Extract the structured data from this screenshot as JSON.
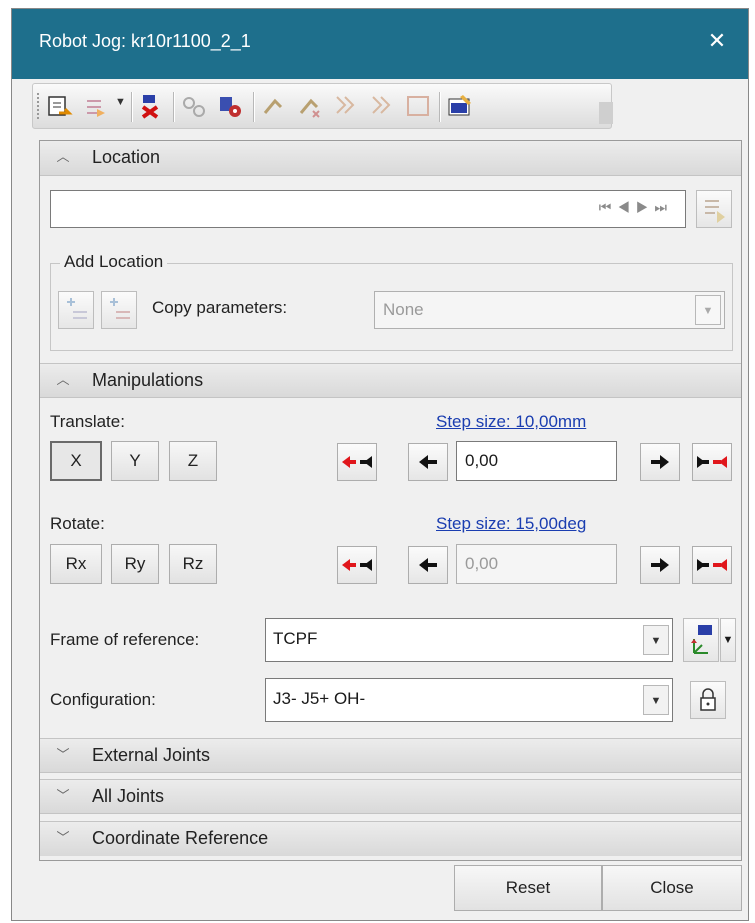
{
  "window": {
    "title": "Robot Jog: kr10r1100_2_1",
    "close_label": "✕"
  },
  "toolbar": {
    "icons": [
      "add-location-icon",
      "teach-dropdown-icon",
      "delete-location-icon",
      "clone-icon",
      "robot-gear-icon",
      "marker-icon",
      "marker-delete-icon",
      "path-icon",
      "path-delete-icon",
      "frame-icon",
      "properties-icon"
    ]
  },
  "location": {
    "header": "Location",
    "value": "",
    "nav_glyphs": {
      "first": "⏮",
      "prev": "◀",
      "next": "▶",
      "last": "⏭"
    },
    "add_location": {
      "title": "Add Location",
      "copy_parameters_label": "Copy parameters:",
      "copy_parameters_value": "None"
    }
  },
  "manipulations": {
    "header": "Manipulations",
    "translate": {
      "label": "Translate:",
      "step_size": "Step size: 10,00mm",
      "axes": [
        "X",
        "Y",
        "Z"
      ],
      "value": "0,00"
    },
    "rotate": {
      "label": "Rotate:",
      "step_size": "Step size: 15,00deg",
      "axes": [
        "Rx",
        "Ry",
        "Rz"
      ],
      "value": "0,00"
    },
    "frame_of_reference": {
      "label": "Frame of reference:",
      "value": "TCPF"
    },
    "configuration": {
      "label": "Configuration:",
      "value": "J3- J5+ OH-"
    }
  },
  "sections": {
    "external_joints": "External Joints",
    "all_joints": "All Joints",
    "coordinate_reference": "Coordinate Reference"
  },
  "footer": {
    "reset": "Reset",
    "close": "Close"
  },
  "colors": {
    "titlebar": "#1e6f8c",
    "link": "#1a3db0",
    "arrow_red": "#e0161b"
  }
}
